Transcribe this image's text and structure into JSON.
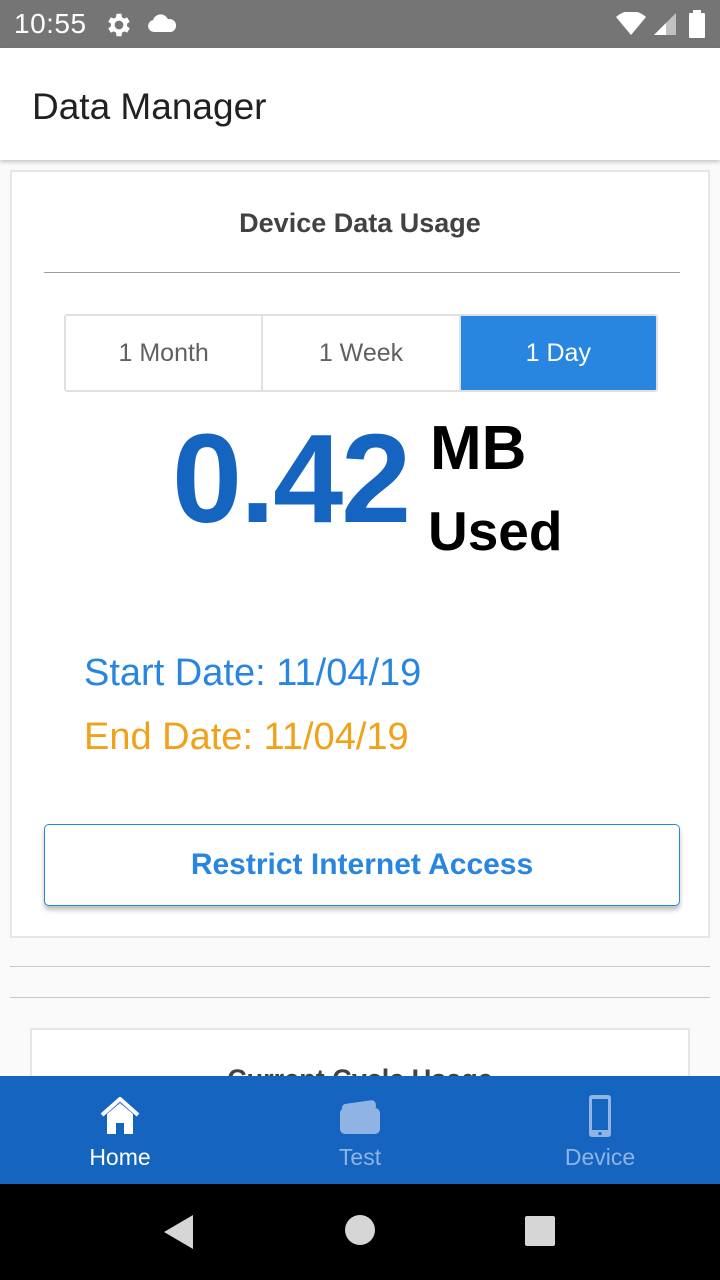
{
  "status_bar": {
    "time": "10:55",
    "icons": [
      "gear-icon",
      "cloud-icon",
      "wifi-icon",
      "signal-icon",
      "battery-icon"
    ]
  },
  "app_bar": {
    "title": "Data Manager"
  },
  "usage_card": {
    "title": "Device Data Usage",
    "periods": [
      {
        "label": "1 Month",
        "selected": false
      },
      {
        "label": "1 Week",
        "selected": false
      },
      {
        "label": "1 Day",
        "selected": true
      }
    ],
    "usage_value": "0.42",
    "usage_unit": "MB",
    "usage_label": "Used",
    "start_date": "Start Date: 11/04/19",
    "end_date": "End Date: 11/04/19",
    "restrict_button_label": "Restrict Internet Access"
  },
  "next_card": {
    "title": "Current Cycle Usage"
  },
  "bottom_nav": {
    "items": [
      {
        "label": "Home",
        "icon": "home-icon",
        "active": true
      },
      {
        "label": "Test",
        "icon": "wallet-icon",
        "active": false
      },
      {
        "label": "Device",
        "icon": "phone-icon",
        "active": false
      }
    ]
  },
  "system_nav": {
    "icons": [
      "back-icon",
      "home-circle-icon",
      "recents-icon"
    ]
  },
  "colors": {
    "status_bar": "#757575",
    "primary": "#1565c0",
    "accent_blue": "#2986e0",
    "end_date_orange": "#f0a21a",
    "inactive_nav": "#8fb3e3"
  }
}
